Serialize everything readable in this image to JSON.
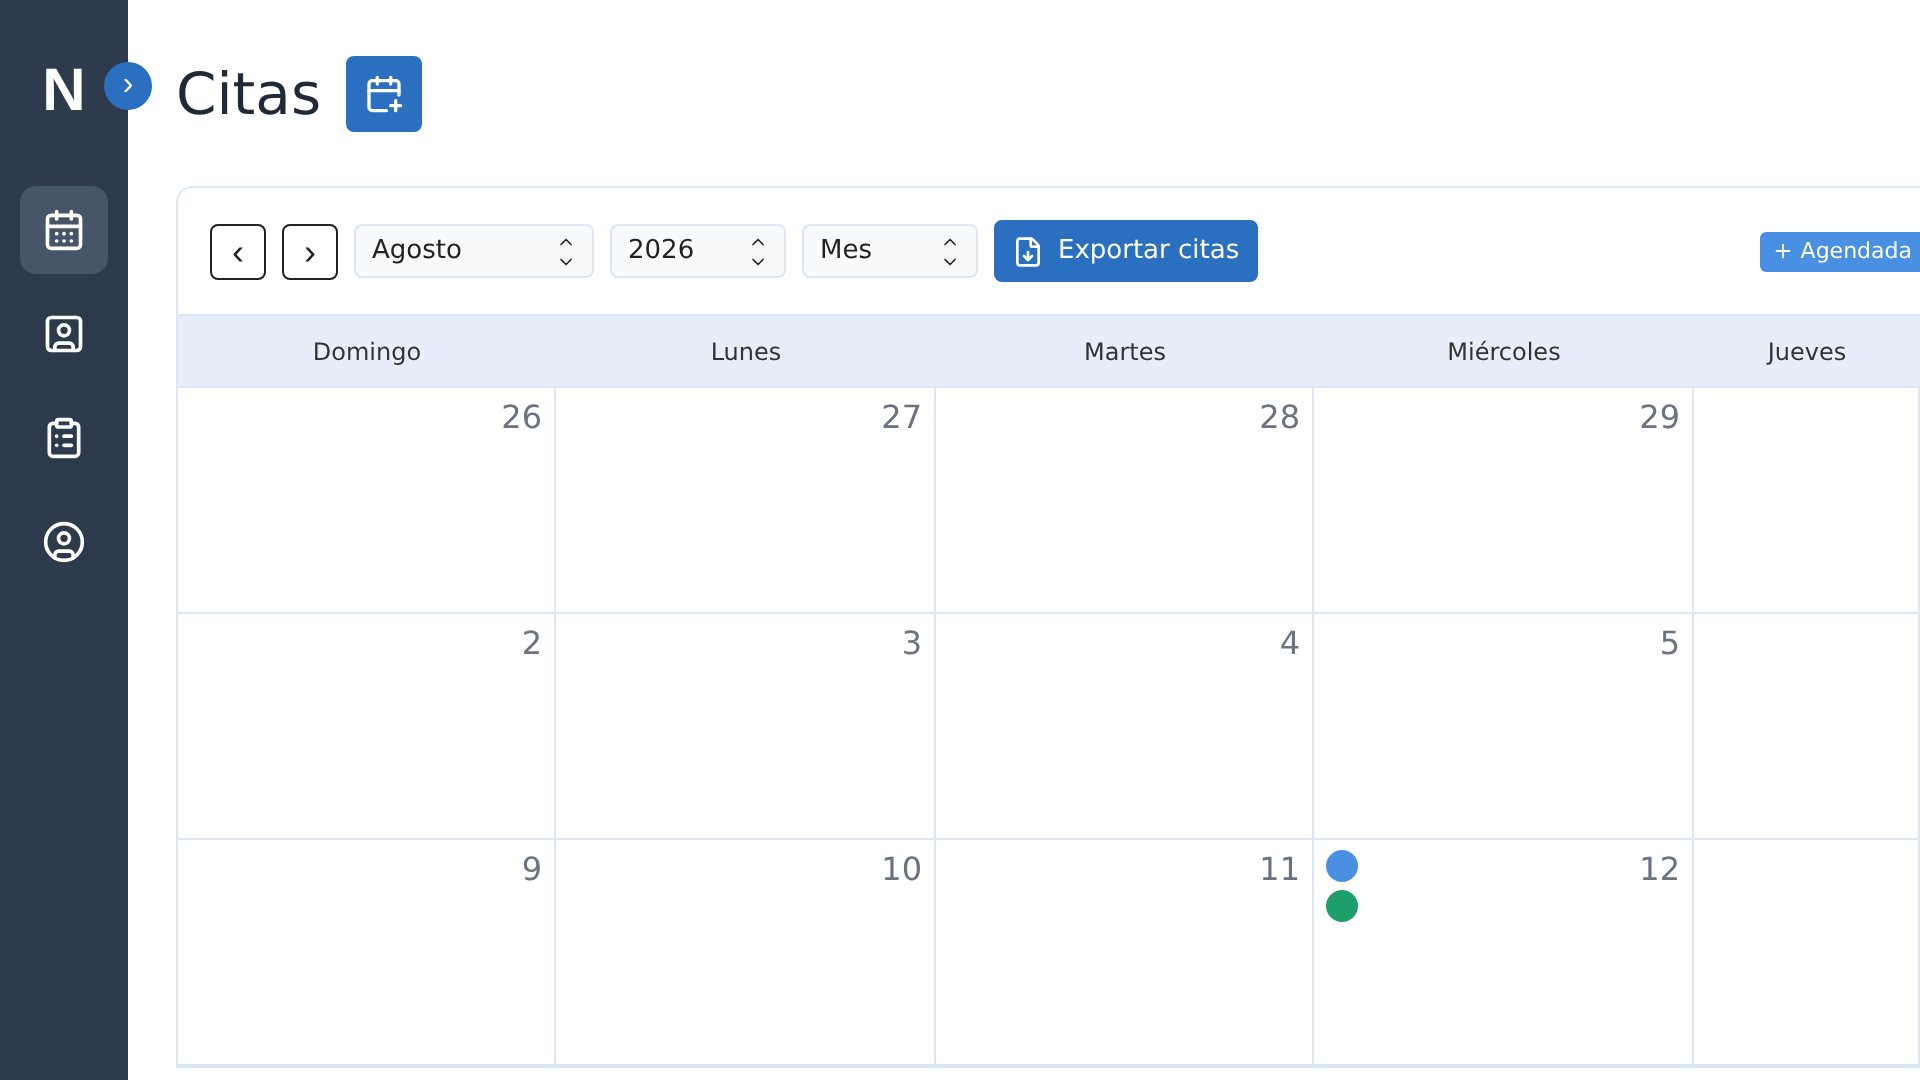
{
  "sidebar": {
    "logo": "N",
    "expand_button": "›",
    "items": [
      {
        "kind": "calendar",
        "selected": true
      },
      {
        "kind": "contacts",
        "selected": false
      },
      {
        "kind": "clipboard",
        "selected": false
      },
      {
        "kind": "user",
        "selected": false
      }
    ]
  },
  "header": {
    "title": "Citas"
  },
  "toolbar": {
    "prev": "‹",
    "next": "›",
    "month": "Agosto",
    "year": "2026",
    "view": "Mes",
    "export_label": "Exportar citas",
    "status_button": "Agendada"
  },
  "calendar": {
    "columns": [
      "Domingo",
      "Lunes",
      "Martes",
      "Miércoles",
      "Jueves"
    ],
    "weeks": [
      [
        {
          "day": "26"
        },
        {
          "day": "27"
        },
        {
          "day": "28"
        },
        {
          "day": "29"
        }
      ],
      [
        {
          "day": "2"
        },
        {
          "day": "3"
        },
        {
          "day": "4"
        },
        {
          "day": "5"
        }
      ],
      [
        {
          "day": "9"
        },
        {
          "day": "10"
        },
        {
          "day": "11"
        },
        {
          "day": "12",
          "events": [
            {
              "color": "#4a90e2"
            },
            {
              "color": "#1e9e6a"
            }
          ]
        }
      ]
    ]
  }
}
